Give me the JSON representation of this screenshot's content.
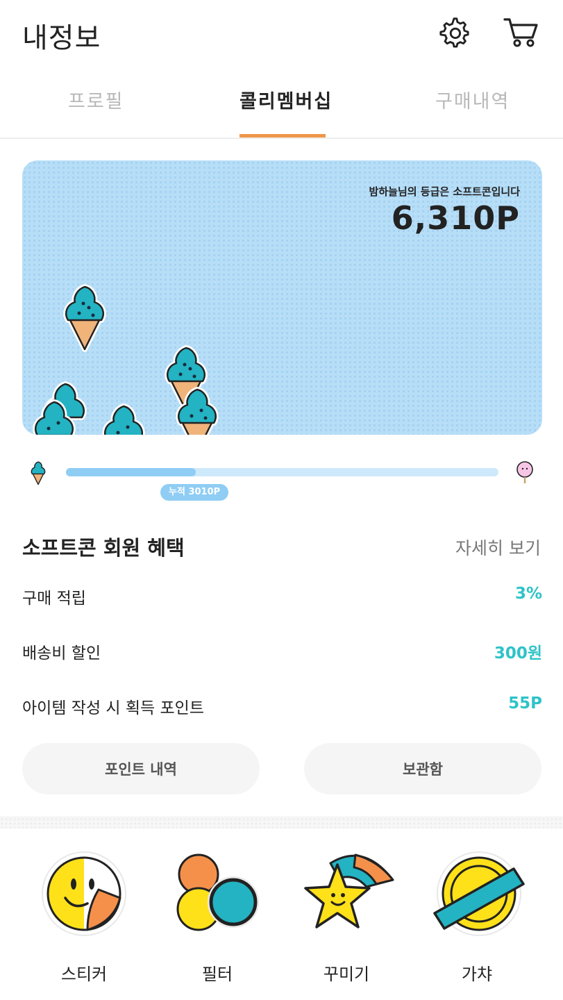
{
  "header": {
    "title": "내정보",
    "settings_icon": "gear-icon",
    "cart_icon": "cart-icon"
  },
  "tabs": [
    {
      "label": "프로필",
      "active": false
    },
    {
      "label": "콜리멤버십",
      "active": true
    },
    {
      "label": "구매내역",
      "active": false
    }
  ],
  "card": {
    "grade_text": "밤하늘님의 등급은 소프트콘입니다",
    "points": "6,310P",
    "illustration": "softcone-ice-cream-icons"
  },
  "progress": {
    "current_icon": "softcone-icon",
    "next_icon": "cotton-candy-icon",
    "fraction": 0.3,
    "badge": "누적 3010P"
  },
  "benefits": {
    "title": "소프트콘 회원 혜택",
    "more_label": "자세히 보기",
    "rows": [
      {
        "label": "구매 적립",
        "value": "3%"
      },
      {
        "label": "배송비 할인",
        "value": "300원"
      },
      {
        "label": "아이템 작성 시 획득 포인트",
        "value": "55P"
      }
    ],
    "buttons": {
      "points_history": "포인트 내역",
      "storage": "보관함"
    }
  },
  "menu": [
    {
      "label": "스티커",
      "icon": "smiley-sticker-icon"
    },
    {
      "label": "필터",
      "icon": "filter-circles-icon"
    },
    {
      "label": "꾸미기",
      "icon": "shooting-star-icon"
    },
    {
      "label": "가챠",
      "icon": "gacha-coin-icon"
    }
  ],
  "colors": {
    "accent": "#f0964a",
    "teal": "#2ec3c8",
    "card_bg": "#b7def7",
    "progress": "#8fcdf4"
  }
}
